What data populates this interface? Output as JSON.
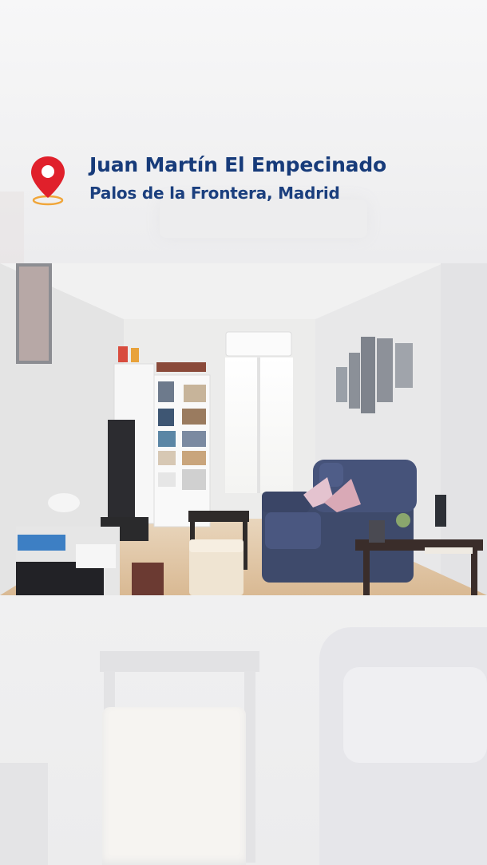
{
  "location": {
    "title": "Juan Martín El Empecinado",
    "subtitle": "Palos de la Frontera, Madrid",
    "pin_color": "#e0202b",
    "icon": "map-pin-icon"
  },
  "colors": {
    "title": "#173b7a",
    "background": "#f3f3f4"
  }
}
